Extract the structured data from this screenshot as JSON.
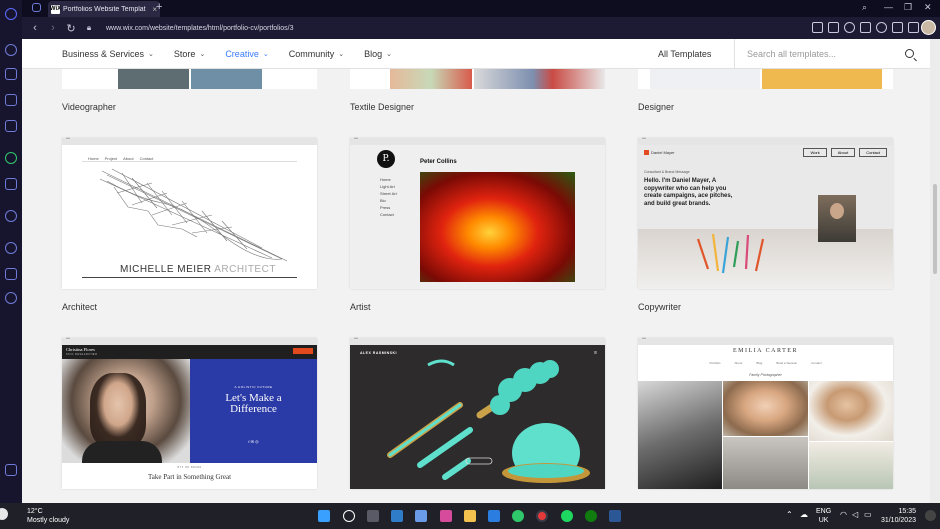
{
  "browser": {
    "tab_title": "Portfolios Website Templat",
    "tab_favicon": "WiX",
    "url": "www.wix.com/website/templates/html/portfolio-cv/portfolios/3"
  },
  "nav": {
    "items": [
      {
        "label": "Business & Services",
        "active": false
      },
      {
        "label": "Store",
        "active": false
      },
      {
        "label": "Creative",
        "active": true
      },
      {
        "label": "Community",
        "active": false
      },
      {
        "label": "Blog",
        "active": false
      }
    ],
    "all_templates": "All Templates",
    "search_placeholder": "Search all templates..."
  },
  "templates": {
    "row1": [
      "Videographer",
      "Textile Designer",
      "Designer"
    ],
    "architect": {
      "label": "Architect",
      "brand": "MICHELLE MEIER",
      "brand_suffix": "ARCHITECT",
      "menu": [
        "Home",
        "Project",
        "About",
        "Contact"
      ]
    },
    "artist": {
      "label": "Artist",
      "logo": "P.",
      "name": "Peter Collins",
      "menu": [
        "Home",
        "Light Art",
        "Street Art",
        "Bio",
        "Press",
        "Contact"
      ]
    },
    "copywriter": {
      "label": "Copywriter",
      "site": "Daniel Mayer",
      "buttons": [
        "Work",
        "About",
        "Contact"
      ],
      "kicker": "Consultant & Brand Message",
      "headline": "Hello. I'm Daniel Mayer, A copywriter who can help you create campaigns, ace pitches, and build great brands."
    },
    "christina": {
      "name": "Christina Flores",
      "sub": "SKIN RESEARCHER",
      "kicker": "A HOLISTIC FUTURE",
      "headline": "Let's Make a Difference",
      "phone": "877 90 89400",
      "footer": "Take Part in Something Great"
    },
    "alex": {
      "name": "ALEX RASMINSKI"
    },
    "emilia": {
      "name": "EMILIA CARTER",
      "sub": "Family Photographer",
      "menu": [
        "Portfolio",
        "About",
        "Blog",
        "Book a Session",
        "Contact"
      ]
    }
  },
  "taskbar": {
    "temp": "12°C",
    "weather": "Mostly cloudy",
    "lang1": "ENG",
    "lang2": "UK",
    "time": "15:35",
    "date": "31/10/2023"
  }
}
